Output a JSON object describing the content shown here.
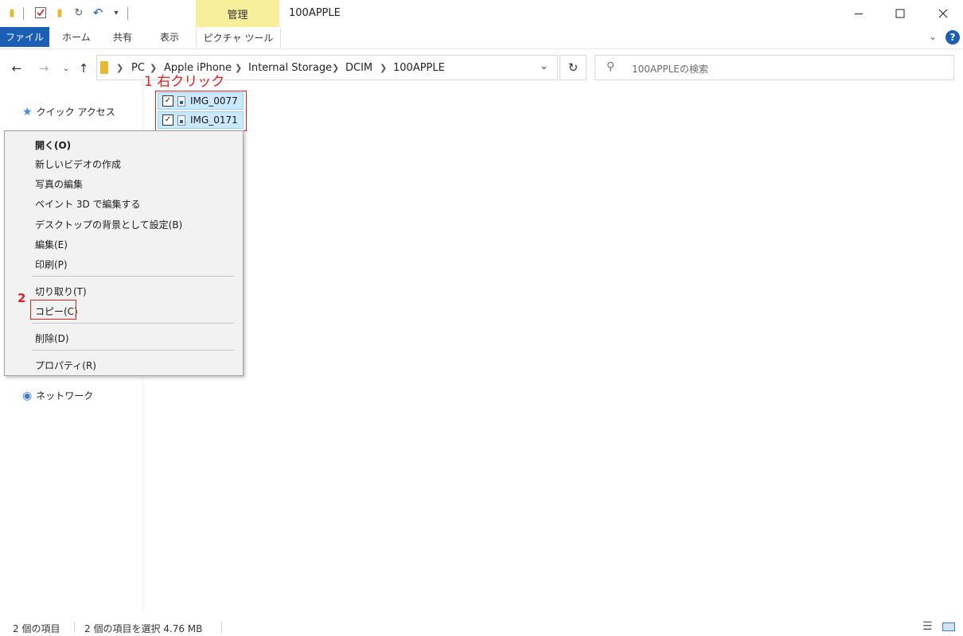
{
  "titlebar": {
    "contextual_tab_label": "管理",
    "window_title": "100APPLE",
    "minimize_icon": "minimize-icon",
    "maximize_icon": "maximize-icon",
    "close_icon": "close-icon"
  },
  "ribbon": {
    "tabs": [
      {
        "label": "ファイル"
      },
      {
        "label": "ホーム"
      },
      {
        "label": "共有"
      },
      {
        "label": "表示"
      },
      {
        "label": "ピクチャ ツール"
      }
    ]
  },
  "address": {
    "breadcrumbs": [
      "PC",
      "Apple iPhone",
      "Internal Storage",
      "DCIM",
      "100APPLE"
    ]
  },
  "search": {
    "placeholder": "100APPLEの検索"
  },
  "navpane": {
    "quick_access": "クイック アクセス",
    "network": "ネットワーク"
  },
  "files": [
    {
      "name": "IMG_0077",
      "checked": true
    },
    {
      "name": "IMG_0171",
      "checked": true
    }
  ],
  "context_menu": {
    "items": [
      {
        "label": "開く(O)",
        "bold": true
      },
      {
        "label": "新しいビデオの作成"
      },
      {
        "label": "写真の編集"
      },
      {
        "label": "ペイント 3D で編集する"
      },
      {
        "label": "デスクトップの背景として設定(B)"
      },
      {
        "label": "編集(E)"
      },
      {
        "label": "印刷(P)"
      },
      {
        "label": "切り取り(T)"
      },
      {
        "label": "コピー(C)"
      },
      {
        "label": "削除(D)"
      },
      {
        "label": "プロパティ(R)"
      }
    ]
  },
  "annotations": {
    "step1": "1 右クリック",
    "step2": "2"
  },
  "statusbar": {
    "item_count": "2 個の項目",
    "selection": "2 個の項目を選択  4.76 MB"
  },
  "colors": {
    "accent": "#1a5fb4",
    "contextual_tab": "#f7ef9c",
    "selection_fill": "#cce8ff",
    "annotation": "#e02020"
  }
}
